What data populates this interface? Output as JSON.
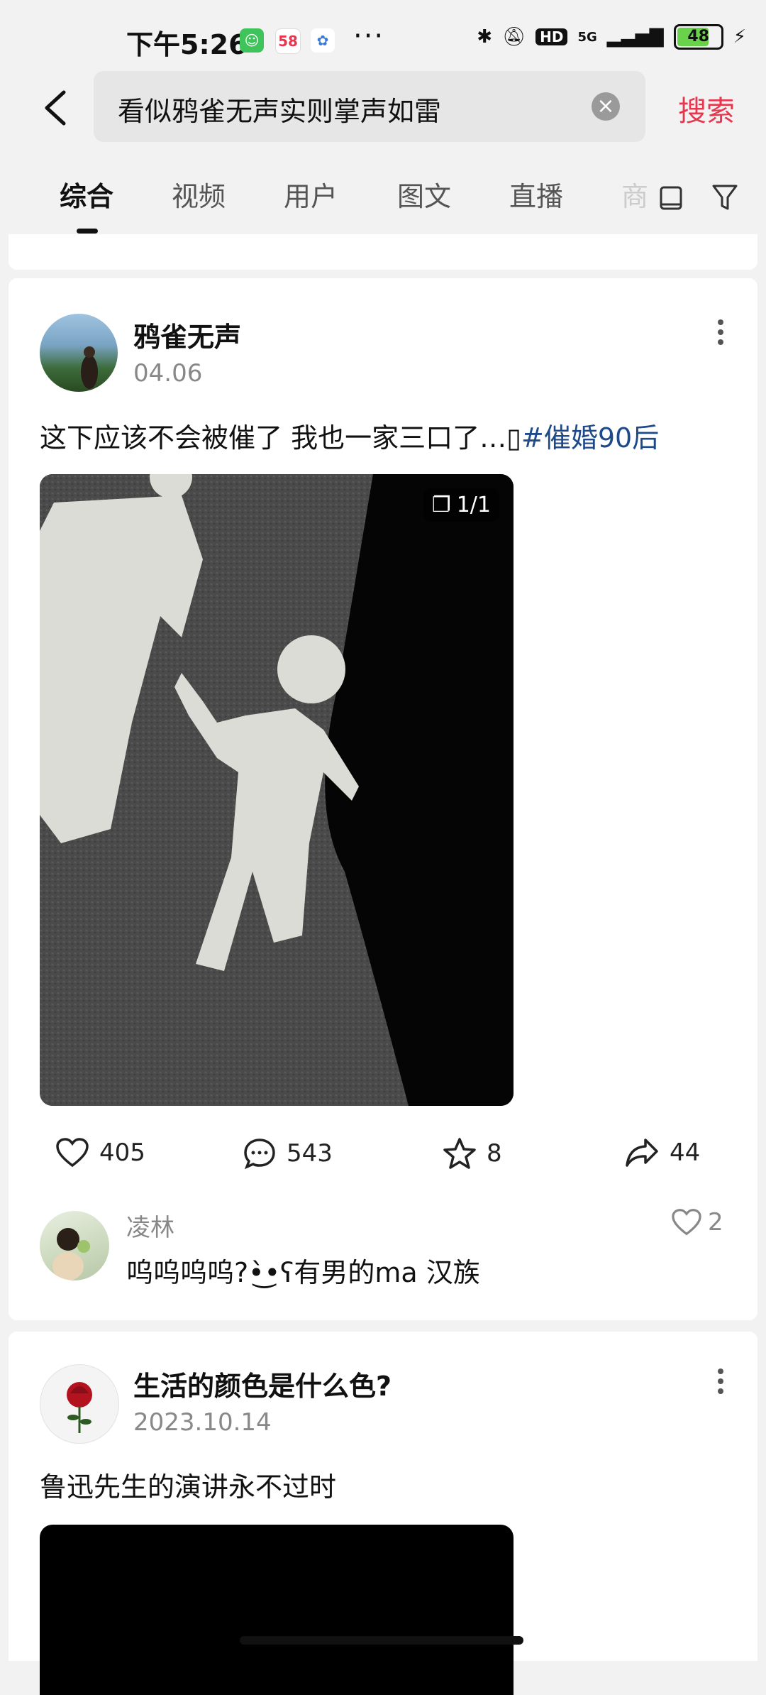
{
  "status_bar": {
    "time": "下午5:26",
    "network": "5G",
    "battery": "48",
    "app_58": "58"
  },
  "search": {
    "query": "看似鸦雀无声实则掌声如雷",
    "button": "搜索"
  },
  "tabs": [
    "综合",
    "视频",
    "用户",
    "图文",
    "直播",
    "商"
  ],
  "posts": [
    {
      "author": "鸦雀无声",
      "date": "04.06",
      "text": "这下应该不会被催了 我也一家三口了…",
      "hashtag": "#催婚90后",
      "image_counter": "1/1",
      "likes": "405",
      "comments": "543",
      "favorites": "8",
      "shares": "44",
      "top_comment": {
        "user": "凌林",
        "text": "呜呜呜呜?•̀͜•ʕ有男的ma 汉族",
        "likes": "2"
      }
    },
    {
      "author": "生活的颜色是什么色?",
      "date": "2023.10.14",
      "text": "鲁迅先生的演讲永不过时"
    }
  ],
  "colors": {
    "accent": "#e8364f",
    "hashtag": "#1e4a8a",
    "background": "#f2f2f2"
  }
}
